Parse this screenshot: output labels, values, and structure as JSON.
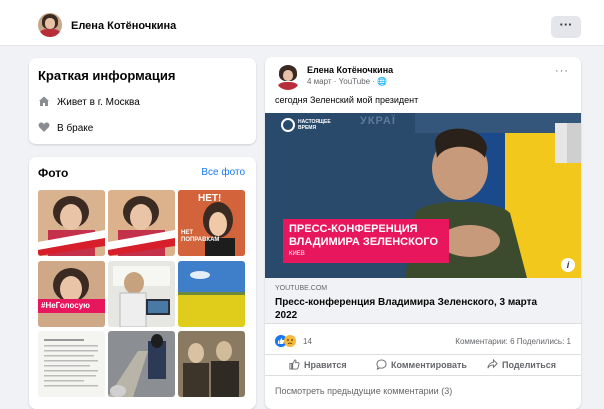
{
  "topbar": {
    "name": "Елена Котёночкина",
    "more_label": "···"
  },
  "intro": {
    "title": "Краткая информация",
    "lives": "Живет в г. Москва",
    "relationship": "В браке"
  },
  "photos": {
    "title": "Фото",
    "all_label": "Все фото",
    "tile_texts": {
      "net": "НЕТ!",
      "net_popravkam": "НЕТ ПОПРАВКАМ",
      "hashtag": "#НеГолосую"
    }
  },
  "post": {
    "author": "Елена Котёночкина",
    "meta": "4 март · YouTube · 🌐",
    "more": "···",
    "text": "сегодня Зеленский мой президент",
    "video": {
      "channel": "НАСТОЯЩЕЕ ВРЕМЯ",
      "bg_text": "УКРАЇ",
      "banner_line1": "ПРЕСС-КОНФЕРЕНЦИЯ",
      "banner_line2": "ВЛАДИМИРА ЗЕЛЕНСКОГО",
      "location": "КИЕВ",
      "info": "i"
    },
    "link": {
      "domain": "YOUTUBE.COM",
      "title": "Пресс-конференция Владимира Зеленского, 3 марта 2022"
    },
    "reaction_count": "14",
    "stats": "Комментарии: 6   Поделились: 1",
    "actions": {
      "like": "Нравится",
      "comment": "Комментировать",
      "share": "Поделиться"
    },
    "prev_comments": "Посмотреть предыдущие комментарии (3)"
  },
  "colors": {
    "accent": "#1877f2",
    "banner": "#e8175d"
  }
}
